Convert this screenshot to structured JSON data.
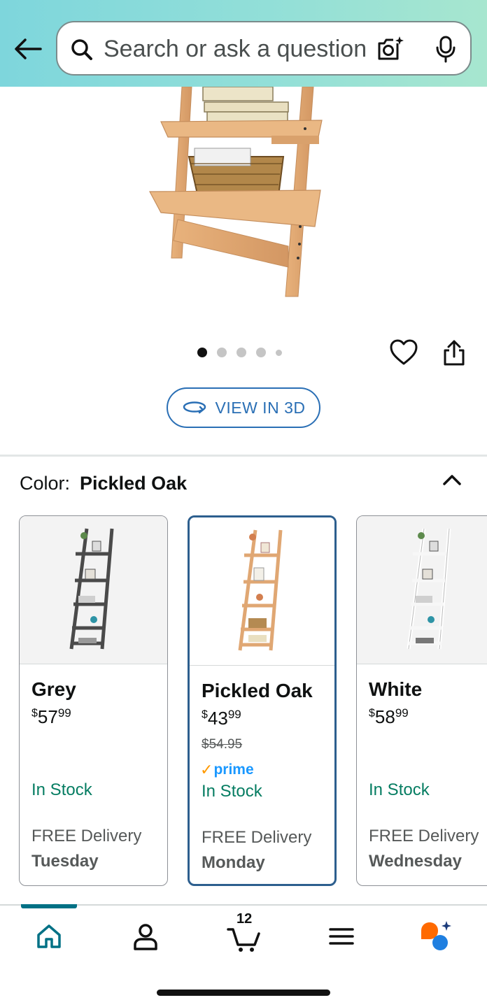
{
  "header": {
    "search_placeholder": "Search or ask a question"
  },
  "gallery": {
    "dot_count": 5,
    "active_dot": 0,
    "view_3d_label": "VIEW IN 3D"
  },
  "color_selector": {
    "label": "Color:",
    "selected_value": "Pickled Oak",
    "variants": [
      {
        "name": "Grey",
        "price_whole": "57",
        "price_cents": "99",
        "currency": "$",
        "list_price": "",
        "prime": "",
        "stock": "In Stock",
        "delivery": "FREE Delivery",
        "delivery_day": "Tuesday",
        "selected": false
      },
      {
        "name": "Pickled Oak",
        "price_whole": "43",
        "price_cents": "99",
        "currency": "$",
        "list_price": "$54.95",
        "prime": "prime",
        "stock": "In Stock",
        "delivery": "FREE Delivery",
        "delivery_day": "Monday",
        "selected": true
      },
      {
        "name": "White",
        "price_whole": "58",
        "price_cents": "99",
        "currency": "$",
        "list_price": "",
        "prime": "",
        "stock": "In Stock",
        "delivery": "FREE Delivery",
        "delivery_day": "Wednesday",
        "selected": false
      }
    ]
  },
  "bottom_nav": {
    "items": [
      "home-icon",
      "account-icon",
      "cart-icon",
      "menu-icon",
      "rufus-icon"
    ],
    "active": "home",
    "cart_count": "12"
  },
  "colors": {
    "header_gradient_start": "#7ed6dc",
    "header_gradient_end": "#a7e6cf",
    "accent_blue": "#2a6fb5",
    "selected_border": "#2d5f8e",
    "stock_green": "#067d62",
    "nav_teal": "#007185"
  }
}
